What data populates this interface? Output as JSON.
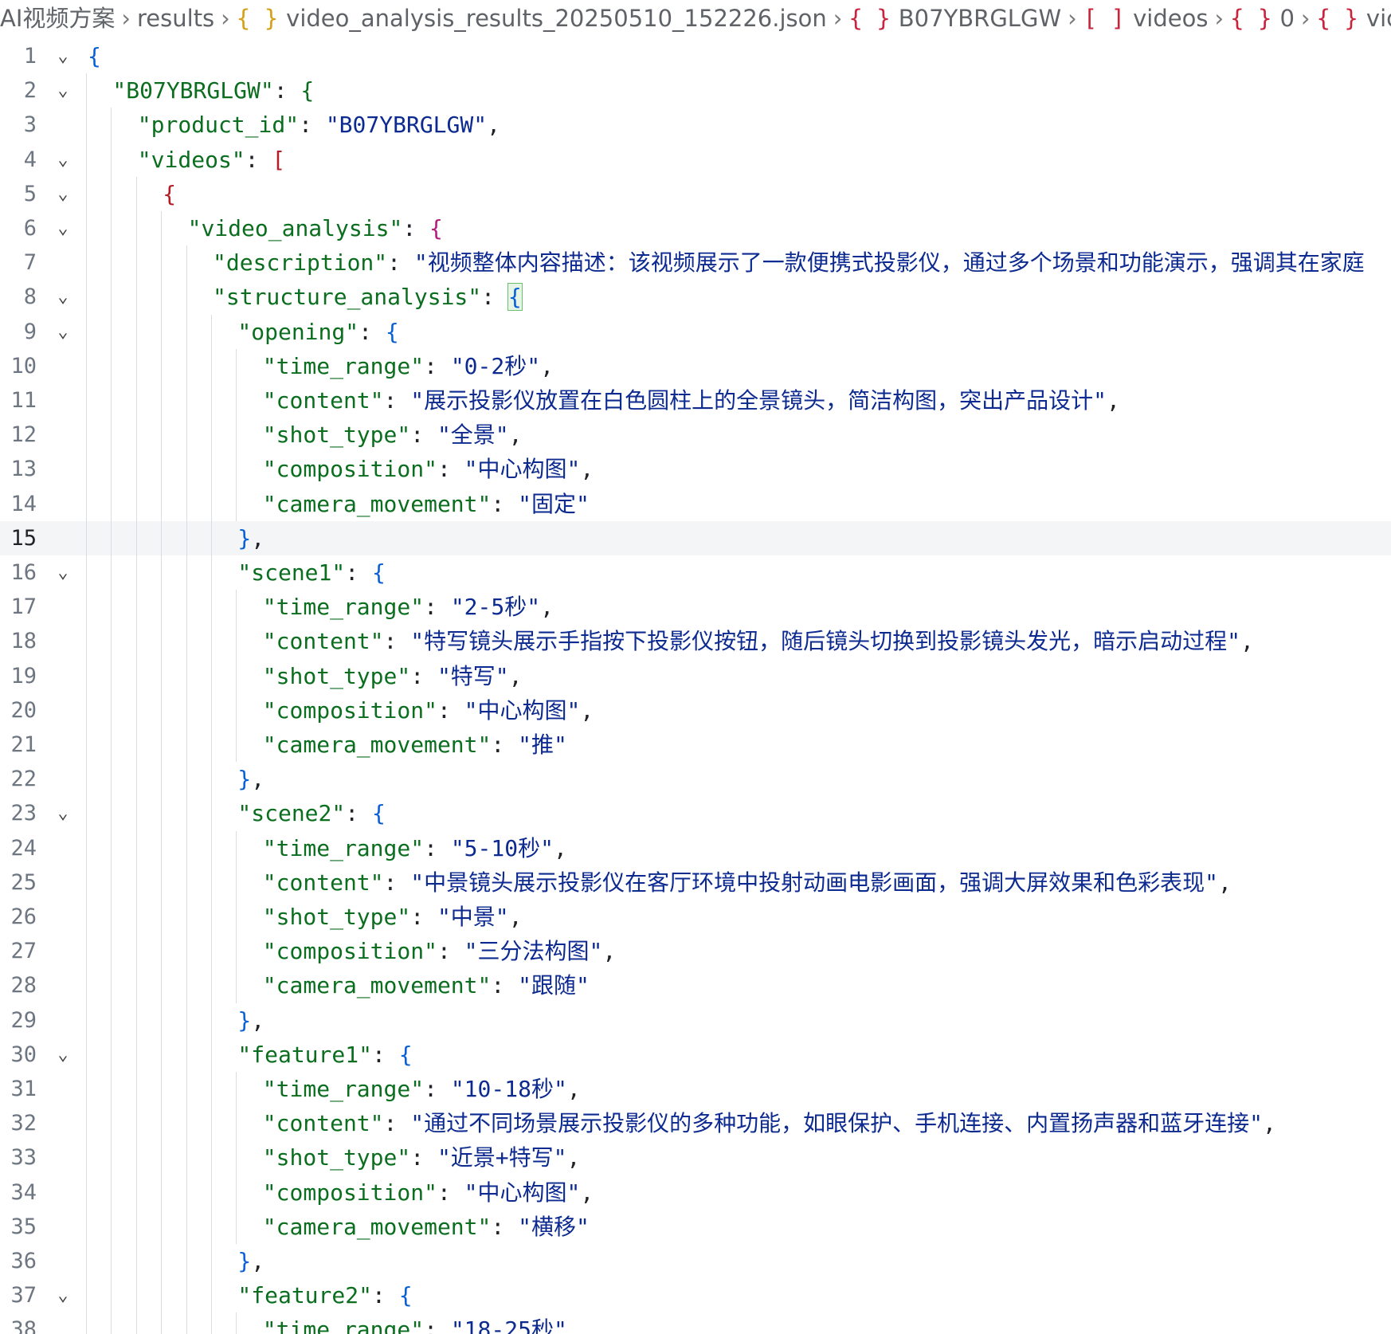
{
  "breadcrumb": [
    {
      "icon": "",
      "label": "AI视频方案"
    },
    {
      "icon": "",
      "label": "results"
    },
    {
      "icon": "{ }",
      "label": "video_analysis_results_20250510_152226.json"
    },
    {
      "icon": "{ }",
      "label": "B07YBRGLGW"
    },
    {
      "icon": "[ ]",
      "label": "videos"
    },
    {
      "icon": "{ }",
      "label": "0"
    },
    {
      "icon": "{ }",
      "label": "vic"
    }
  ],
  "editor": {
    "current_line": 15,
    "lines": [
      {
        "n": "1",
        "fold": true,
        "indent": 0,
        "parts": [
          [
            "b1",
            "{"
          ]
        ]
      },
      {
        "n": "2",
        "fold": true,
        "indent": 1,
        "parts": [
          [
            "k",
            "\"B07YBRGLGW\""
          ],
          [
            "p",
            ": "
          ],
          [
            "b2",
            "{"
          ]
        ]
      },
      {
        "n": "3",
        "fold": false,
        "indent": 2,
        "parts": [
          [
            "k",
            "\"product_id\""
          ],
          [
            "p",
            ": "
          ],
          [
            "s",
            "\"B07YBRGLGW\""
          ],
          [
            "p",
            ","
          ]
        ]
      },
      {
        "n": "4",
        "fold": true,
        "indent": 2,
        "parts": [
          [
            "k",
            "\"videos\""
          ],
          [
            "p",
            ": "
          ],
          [
            "b3",
            "["
          ]
        ]
      },
      {
        "n": "5",
        "fold": true,
        "indent": 3,
        "parts": [
          [
            "b3",
            "{"
          ]
        ]
      },
      {
        "n": "6",
        "fold": true,
        "indent": 4,
        "parts": [
          [
            "k",
            "\"video_analysis\""
          ],
          [
            "p",
            ": "
          ],
          [
            "b4",
            "{"
          ]
        ]
      },
      {
        "n": "7",
        "fold": false,
        "indent": 5,
        "parts": [
          [
            "k",
            "\"description\""
          ],
          [
            "p",
            ": "
          ],
          [
            "s",
            "\"视频整体内容描述：该视频展示了一款便携式投影仪，通过多个场景和功能演示，强调其在家庭"
          ]
        ]
      },
      {
        "n": "8",
        "fold": true,
        "indent": 5,
        "parts": [
          [
            "k",
            "\"structure_analysis\""
          ],
          [
            "p",
            ": "
          ],
          [
            "b1 bm",
            "{"
          ]
        ]
      },
      {
        "n": "9",
        "fold": true,
        "indent": 6,
        "parts": [
          [
            "k",
            "\"opening\""
          ],
          [
            "p",
            ": "
          ],
          [
            "b1",
            "{"
          ]
        ]
      },
      {
        "n": "10",
        "fold": false,
        "indent": 7,
        "parts": [
          [
            "k",
            "\"time_range\""
          ],
          [
            "p",
            ": "
          ],
          [
            "s",
            "\"0-2秒\""
          ],
          [
            "p",
            ","
          ]
        ]
      },
      {
        "n": "11",
        "fold": false,
        "indent": 7,
        "parts": [
          [
            "k",
            "\"content\""
          ],
          [
            "p",
            ": "
          ],
          [
            "s",
            "\"展示投影仪放置在白色圆柱上的全景镜头，简洁构图，突出产品设计\""
          ],
          [
            "p",
            ","
          ]
        ]
      },
      {
        "n": "12",
        "fold": false,
        "indent": 7,
        "parts": [
          [
            "k",
            "\"shot_type\""
          ],
          [
            "p",
            ": "
          ],
          [
            "s",
            "\"全景\""
          ],
          [
            "p",
            ","
          ]
        ]
      },
      {
        "n": "13",
        "fold": false,
        "indent": 7,
        "parts": [
          [
            "k",
            "\"composition\""
          ],
          [
            "p",
            ": "
          ],
          [
            "s",
            "\"中心构图\""
          ],
          [
            "p",
            ","
          ]
        ]
      },
      {
        "n": "14",
        "fold": false,
        "indent": 7,
        "parts": [
          [
            "k",
            "\"camera_movement\""
          ],
          [
            "p",
            ": "
          ],
          [
            "s",
            "\"固定\""
          ]
        ]
      },
      {
        "n": "15",
        "fold": false,
        "indent": 6,
        "parts": [
          [
            "b1",
            "}"
          ],
          [
            "p",
            ","
          ]
        ]
      },
      {
        "n": "16",
        "fold": true,
        "indent": 6,
        "parts": [
          [
            "k",
            "\"scene1\""
          ],
          [
            "p",
            ": "
          ],
          [
            "b1",
            "{"
          ]
        ]
      },
      {
        "n": "17",
        "fold": false,
        "indent": 7,
        "parts": [
          [
            "k",
            "\"time_range\""
          ],
          [
            "p",
            ": "
          ],
          [
            "s",
            "\"2-5秒\""
          ],
          [
            "p",
            ","
          ]
        ]
      },
      {
        "n": "18",
        "fold": false,
        "indent": 7,
        "parts": [
          [
            "k",
            "\"content\""
          ],
          [
            "p",
            ": "
          ],
          [
            "s",
            "\"特写镜头展示手指按下投影仪按钮，随后镜头切换到投影镜头发光，暗示启动过程\""
          ],
          [
            "p",
            ","
          ]
        ]
      },
      {
        "n": "19",
        "fold": false,
        "indent": 7,
        "parts": [
          [
            "k",
            "\"shot_type\""
          ],
          [
            "p",
            ": "
          ],
          [
            "s",
            "\"特写\""
          ],
          [
            "p",
            ","
          ]
        ]
      },
      {
        "n": "20",
        "fold": false,
        "indent": 7,
        "parts": [
          [
            "k",
            "\"composition\""
          ],
          [
            "p",
            ": "
          ],
          [
            "s",
            "\"中心构图\""
          ],
          [
            "p",
            ","
          ]
        ]
      },
      {
        "n": "21",
        "fold": false,
        "indent": 7,
        "parts": [
          [
            "k",
            "\"camera_movement\""
          ],
          [
            "p",
            ": "
          ],
          [
            "s",
            "\"推\""
          ]
        ]
      },
      {
        "n": "22",
        "fold": false,
        "indent": 6,
        "parts": [
          [
            "b1",
            "}"
          ],
          [
            "p",
            ","
          ]
        ]
      },
      {
        "n": "23",
        "fold": true,
        "indent": 6,
        "parts": [
          [
            "k",
            "\"scene2\""
          ],
          [
            "p",
            ": "
          ],
          [
            "b1",
            "{"
          ]
        ]
      },
      {
        "n": "24",
        "fold": false,
        "indent": 7,
        "parts": [
          [
            "k",
            "\"time_range\""
          ],
          [
            "p",
            ": "
          ],
          [
            "s",
            "\"5-10秒\""
          ],
          [
            "p",
            ","
          ]
        ]
      },
      {
        "n": "25",
        "fold": false,
        "indent": 7,
        "parts": [
          [
            "k",
            "\"content\""
          ],
          [
            "p",
            ": "
          ],
          [
            "s",
            "\"中景镜头展示投影仪在客厅环境中投射动画电影画面，强调大屏效果和色彩表现\""
          ],
          [
            "p",
            ","
          ]
        ]
      },
      {
        "n": "26",
        "fold": false,
        "indent": 7,
        "parts": [
          [
            "k",
            "\"shot_type\""
          ],
          [
            "p",
            ": "
          ],
          [
            "s",
            "\"中景\""
          ],
          [
            "p",
            ","
          ]
        ]
      },
      {
        "n": "27",
        "fold": false,
        "indent": 7,
        "parts": [
          [
            "k",
            "\"composition\""
          ],
          [
            "p",
            ": "
          ],
          [
            "s",
            "\"三分法构图\""
          ],
          [
            "p",
            ","
          ]
        ]
      },
      {
        "n": "28",
        "fold": false,
        "indent": 7,
        "parts": [
          [
            "k",
            "\"camera_movement\""
          ],
          [
            "p",
            ": "
          ],
          [
            "s",
            "\"跟随\""
          ]
        ]
      },
      {
        "n": "29",
        "fold": false,
        "indent": 6,
        "parts": [
          [
            "b1",
            "}"
          ],
          [
            "p",
            ","
          ]
        ]
      },
      {
        "n": "30",
        "fold": true,
        "indent": 6,
        "parts": [
          [
            "k",
            "\"feature1\""
          ],
          [
            "p",
            ": "
          ],
          [
            "b1",
            "{"
          ]
        ]
      },
      {
        "n": "31",
        "fold": false,
        "indent": 7,
        "parts": [
          [
            "k",
            "\"time_range\""
          ],
          [
            "p",
            ": "
          ],
          [
            "s",
            "\"10-18秒\""
          ],
          [
            "p",
            ","
          ]
        ]
      },
      {
        "n": "32",
        "fold": false,
        "indent": 7,
        "parts": [
          [
            "k",
            "\"content\""
          ],
          [
            "p",
            ": "
          ],
          [
            "s",
            "\"通过不同场景展示投影仪的多种功能，如眼保护、手机连接、内置扬声器和蓝牙连接\""
          ],
          [
            "p",
            ","
          ]
        ]
      },
      {
        "n": "33",
        "fold": false,
        "indent": 7,
        "parts": [
          [
            "k",
            "\"shot_type\""
          ],
          [
            "p",
            ": "
          ],
          [
            "s",
            "\"近景+特写\""
          ],
          [
            "p",
            ","
          ]
        ]
      },
      {
        "n": "34",
        "fold": false,
        "indent": 7,
        "parts": [
          [
            "k",
            "\"composition\""
          ],
          [
            "p",
            ": "
          ],
          [
            "s",
            "\"中心构图\""
          ],
          [
            "p",
            ","
          ]
        ]
      },
      {
        "n": "35",
        "fold": false,
        "indent": 7,
        "parts": [
          [
            "k",
            "\"camera_movement\""
          ],
          [
            "p",
            ": "
          ],
          [
            "s",
            "\"横移\""
          ]
        ]
      },
      {
        "n": "36",
        "fold": false,
        "indent": 6,
        "parts": [
          [
            "b1",
            "}"
          ],
          [
            "p",
            ","
          ]
        ]
      },
      {
        "n": "37",
        "fold": true,
        "indent": 6,
        "parts": [
          [
            "k",
            "\"feature2\""
          ],
          [
            "p",
            ": "
          ],
          [
            "b1",
            "{"
          ]
        ]
      },
      {
        "n": "38",
        "fold": false,
        "indent": 7,
        "parts": [
          [
            "k",
            "\"time_range\""
          ],
          [
            "p",
            ": "
          ],
          [
            "s",
            "\"18-25秒\""
          ],
          [
            "p",
            ","
          ]
        ]
      }
    ]
  }
}
